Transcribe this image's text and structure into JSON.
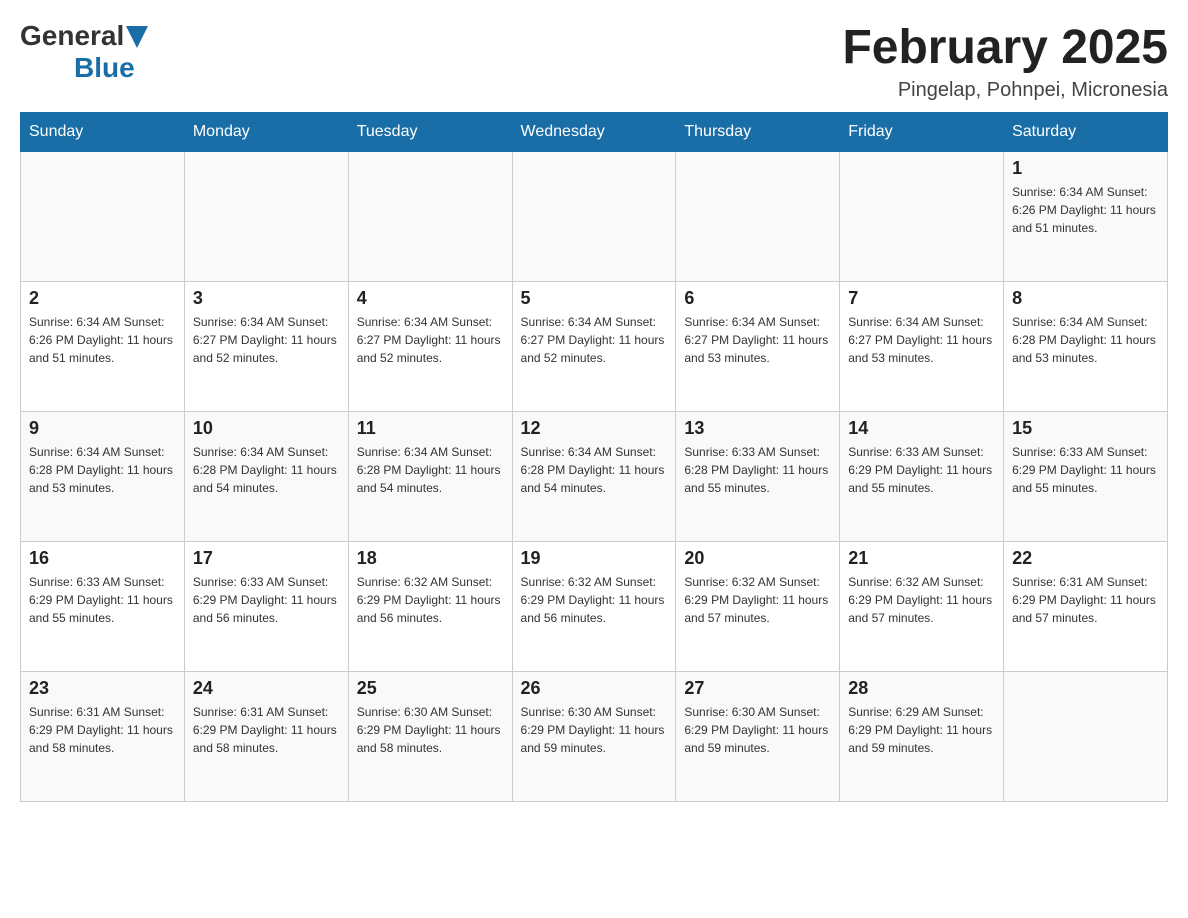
{
  "header": {
    "logo": {
      "part1": "General",
      "part2": "Blue"
    },
    "title": "February 2025",
    "location": "Pingelap, Pohnpei, Micronesia"
  },
  "weekdays": [
    "Sunday",
    "Monday",
    "Tuesday",
    "Wednesday",
    "Thursday",
    "Friday",
    "Saturday"
  ],
  "weeks": [
    [
      {
        "day": "",
        "info": ""
      },
      {
        "day": "",
        "info": ""
      },
      {
        "day": "",
        "info": ""
      },
      {
        "day": "",
        "info": ""
      },
      {
        "day": "",
        "info": ""
      },
      {
        "day": "",
        "info": ""
      },
      {
        "day": "1",
        "info": "Sunrise: 6:34 AM\nSunset: 6:26 PM\nDaylight: 11 hours\nand 51 minutes."
      }
    ],
    [
      {
        "day": "2",
        "info": "Sunrise: 6:34 AM\nSunset: 6:26 PM\nDaylight: 11 hours\nand 51 minutes."
      },
      {
        "day": "3",
        "info": "Sunrise: 6:34 AM\nSunset: 6:27 PM\nDaylight: 11 hours\nand 52 minutes."
      },
      {
        "day": "4",
        "info": "Sunrise: 6:34 AM\nSunset: 6:27 PM\nDaylight: 11 hours\nand 52 minutes."
      },
      {
        "day": "5",
        "info": "Sunrise: 6:34 AM\nSunset: 6:27 PM\nDaylight: 11 hours\nand 52 minutes."
      },
      {
        "day": "6",
        "info": "Sunrise: 6:34 AM\nSunset: 6:27 PM\nDaylight: 11 hours\nand 53 minutes."
      },
      {
        "day": "7",
        "info": "Sunrise: 6:34 AM\nSunset: 6:27 PM\nDaylight: 11 hours\nand 53 minutes."
      },
      {
        "day": "8",
        "info": "Sunrise: 6:34 AM\nSunset: 6:28 PM\nDaylight: 11 hours\nand 53 minutes."
      }
    ],
    [
      {
        "day": "9",
        "info": "Sunrise: 6:34 AM\nSunset: 6:28 PM\nDaylight: 11 hours\nand 53 minutes."
      },
      {
        "day": "10",
        "info": "Sunrise: 6:34 AM\nSunset: 6:28 PM\nDaylight: 11 hours\nand 54 minutes."
      },
      {
        "day": "11",
        "info": "Sunrise: 6:34 AM\nSunset: 6:28 PM\nDaylight: 11 hours\nand 54 minutes."
      },
      {
        "day": "12",
        "info": "Sunrise: 6:34 AM\nSunset: 6:28 PM\nDaylight: 11 hours\nand 54 minutes."
      },
      {
        "day": "13",
        "info": "Sunrise: 6:33 AM\nSunset: 6:28 PM\nDaylight: 11 hours\nand 55 minutes."
      },
      {
        "day": "14",
        "info": "Sunrise: 6:33 AM\nSunset: 6:29 PM\nDaylight: 11 hours\nand 55 minutes."
      },
      {
        "day": "15",
        "info": "Sunrise: 6:33 AM\nSunset: 6:29 PM\nDaylight: 11 hours\nand 55 minutes."
      }
    ],
    [
      {
        "day": "16",
        "info": "Sunrise: 6:33 AM\nSunset: 6:29 PM\nDaylight: 11 hours\nand 55 minutes."
      },
      {
        "day": "17",
        "info": "Sunrise: 6:33 AM\nSunset: 6:29 PM\nDaylight: 11 hours\nand 56 minutes."
      },
      {
        "day": "18",
        "info": "Sunrise: 6:32 AM\nSunset: 6:29 PM\nDaylight: 11 hours\nand 56 minutes."
      },
      {
        "day": "19",
        "info": "Sunrise: 6:32 AM\nSunset: 6:29 PM\nDaylight: 11 hours\nand 56 minutes."
      },
      {
        "day": "20",
        "info": "Sunrise: 6:32 AM\nSunset: 6:29 PM\nDaylight: 11 hours\nand 57 minutes."
      },
      {
        "day": "21",
        "info": "Sunrise: 6:32 AM\nSunset: 6:29 PM\nDaylight: 11 hours\nand 57 minutes."
      },
      {
        "day": "22",
        "info": "Sunrise: 6:31 AM\nSunset: 6:29 PM\nDaylight: 11 hours\nand 57 minutes."
      }
    ],
    [
      {
        "day": "23",
        "info": "Sunrise: 6:31 AM\nSunset: 6:29 PM\nDaylight: 11 hours\nand 58 minutes."
      },
      {
        "day": "24",
        "info": "Sunrise: 6:31 AM\nSunset: 6:29 PM\nDaylight: 11 hours\nand 58 minutes."
      },
      {
        "day": "25",
        "info": "Sunrise: 6:30 AM\nSunset: 6:29 PM\nDaylight: 11 hours\nand 58 minutes."
      },
      {
        "day": "26",
        "info": "Sunrise: 6:30 AM\nSunset: 6:29 PM\nDaylight: 11 hours\nand 59 minutes."
      },
      {
        "day": "27",
        "info": "Sunrise: 6:30 AM\nSunset: 6:29 PM\nDaylight: 11 hours\nand 59 minutes."
      },
      {
        "day": "28",
        "info": "Sunrise: 6:29 AM\nSunset: 6:29 PM\nDaylight: 11 hours\nand 59 minutes."
      },
      {
        "day": "",
        "info": ""
      }
    ]
  ]
}
